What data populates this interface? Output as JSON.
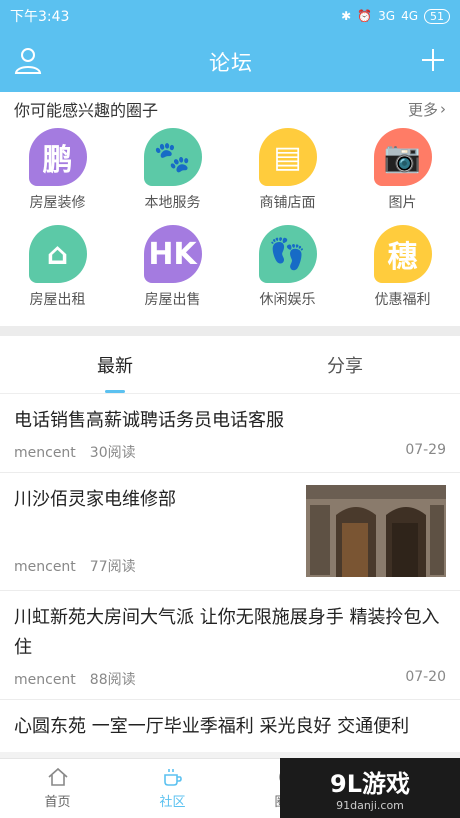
{
  "status": {
    "time": "下午3:43",
    "signal1": "3G",
    "signal2": "4G",
    "battery": "51"
  },
  "nav": {
    "title": "论坛"
  },
  "circles": {
    "heading": "你可能感兴趣的圈子",
    "more": "更多",
    "items": [
      {
        "label": "房屋装修",
        "glyph": "鹏",
        "color": "#a47be0"
      },
      {
        "label": "本地服务",
        "glyph": "🐾",
        "color": "#5cc9a7"
      },
      {
        "label": "商铺店面",
        "glyph": "▤",
        "color": "#ffcc3d"
      },
      {
        "label": "图片",
        "glyph": "📷",
        "color": "#ff7c66"
      },
      {
        "label": "房屋出租",
        "glyph": "⌂",
        "color": "#5cc9a7"
      },
      {
        "label": "房屋出售",
        "glyph": "HK",
        "color": "#a47be0"
      },
      {
        "label": "休闲娱乐",
        "glyph": "👣",
        "color": "#5cc9a7"
      },
      {
        "label": "优惠福利",
        "glyph": "穗",
        "color": "#ffcc3d"
      }
    ]
  },
  "tabs": {
    "latest": "最新",
    "share": "分享"
  },
  "posts": [
    {
      "title": "电话销售高薪诚聘话务员电话客服",
      "author": "mencent",
      "reads": "30阅读",
      "date": "07-29"
    },
    {
      "title": "川沙佰灵家电维修部",
      "author": "mencent",
      "reads": "77阅读",
      "date": ""
    },
    {
      "title": "川虹新苑大房间大气派 让你无限施展身手 精装拎包入住",
      "author": "mencent",
      "reads": "88阅读",
      "date": "07-20"
    },
    {
      "title": "心圆东苑 一室一厅毕业季福利 采光良好 交通便利",
      "author": "",
      "reads": "",
      "date": ""
    }
  ],
  "bottom_nav": {
    "home": "首页",
    "community": "社区",
    "circle": "圈子"
  },
  "watermark": {
    "brand": "9L游戏",
    "site": "91danji.com"
  }
}
